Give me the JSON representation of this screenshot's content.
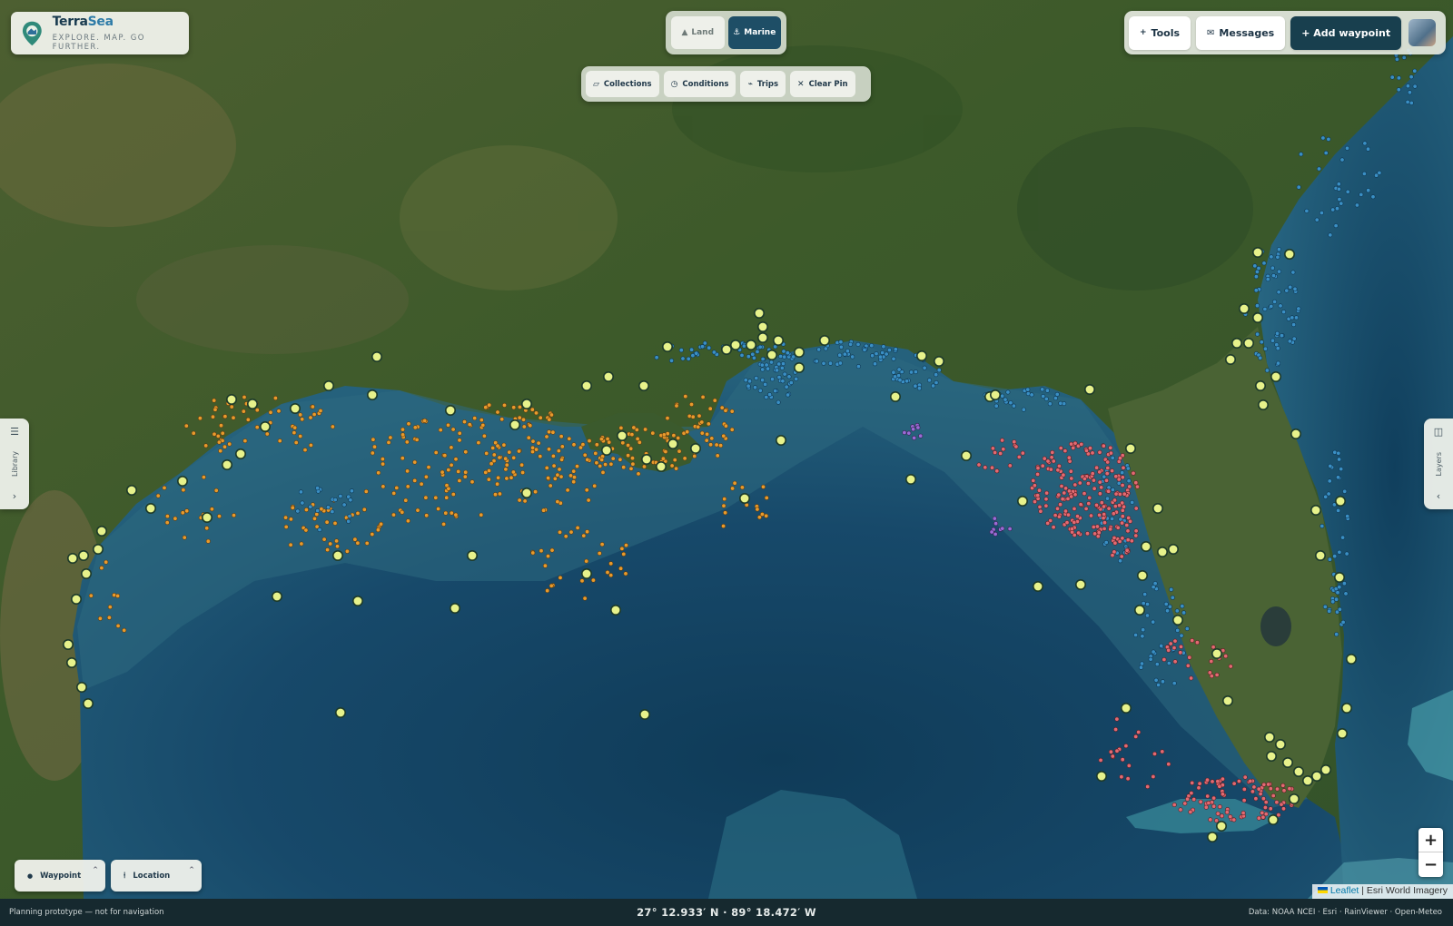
{
  "brand": {
    "name_part1": "Terra",
    "name_part2": "Sea",
    "tagline": "EXPLORE. MAP. GO FURTHER."
  },
  "mode_toggle": {
    "land_label": "Land",
    "marine_label": "Marine",
    "active": "Marine"
  },
  "filters": [
    {
      "label": "Collections",
      "icon": "folder-icon"
    },
    {
      "label": "Conditions",
      "icon": "clock-icon"
    },
    {
      "label": "Trips",
      "icon": "route-icon"
    },
    {
      "label": "Clear Pin",
      "icon": "close-icon"
    }
  ],
  "toolbar": {
    "tools_label": "Tools",
    "messages_label": "Messages",
    "add_waypoint_label": "+ Add waypoint"
  },
  "side_tabs": {
    "library_label": "Library",
    "layers_label": "Layers"
  },
  "zoom": {
    "in_label": "+",
    "out_label": "−"
  },
  "attribution": {
    "leaflet": "Leaflet",
    "separator": " | ",
    "source": "Esri World Imagery"
  },
  "bottom_buttons": {
    "waypoint_label": "Waypoint",
    "location_label": "Location"
  },
  "status": {
    "disclaimer": "Planning prototype — not for navigation",
    "coordinates": "27° 12.933′ N · 89° 18.472′ W",
    "data_sources": "Data: NOAA NCEI · Esri · RainViewer · Open-Meteo"
  },
  "colors": {
    "land": "#3f5a2e",
    "water": "#1d4f6e",
    "deep_water": "#0f3349",
    "waypoint_marker": "#e7f28b",
    "orange_marker": "#e89a2c",
    "blue_marker": "#3a8fc4",
    "red_marker": "#e26a72",
    "purple_marker": "#9a6bd6",
    "accent": "#1e4e66"
  }
}
